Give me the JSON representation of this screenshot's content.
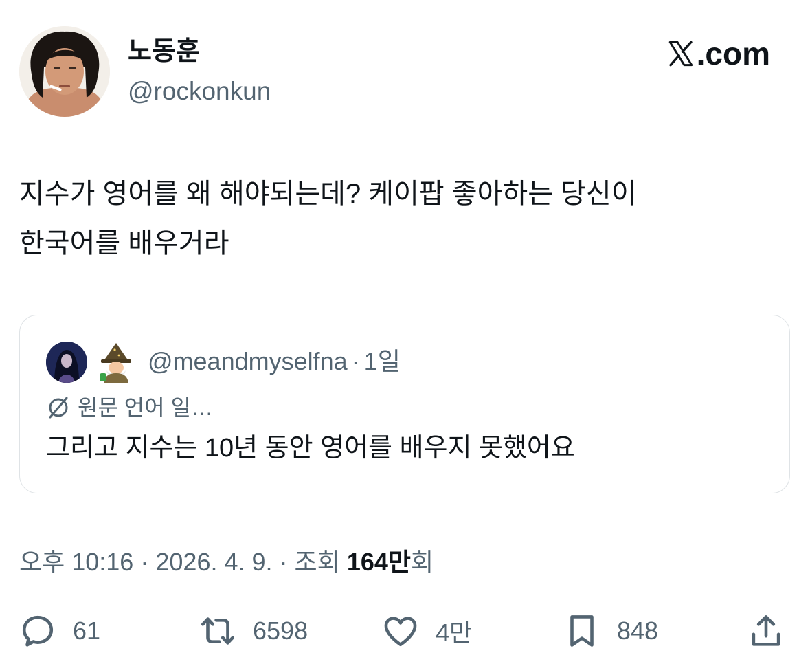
{
  "author": {
    "display_name": "노동훈",
    "handle": "@rockonkun"
  },
  "brand": {
    "label": ".com",
    "icon": "x-logo-icon"
  },
  "tweet": {
    "line1": "지수가 영어를 왜 해야되는데? 케이팝 좋아하는 당신이",
    "line2": "한국어를 배우거라"
  },
  "quoted": {
    "handle": "@meandmyselfna",
    "separator": "·",
    "age": "1일",
    "translate_label": "원문 언어 일…",
    "text": "그리고 지수는 10년 동안 영어를 배우지 못했어요"
  },
  "meta": {
    "time": "오후 10:16",
    "sep1": "·",
    "date": "2026. 4. 9.",
    "sep2": "·",
    "views_label": "조회",
    "views_value": "164만",
    "views_suffix": "회"
  },
  "actions": {
    "replies": "61",
    "reposts": "6598",
    "likes": "4만",
    "bookmarks": "848"
  },
  "colors": {
    "text": "#0f1419",
    "secondary": "#536471",
    "border": "#dfe3e6"
  }
}
